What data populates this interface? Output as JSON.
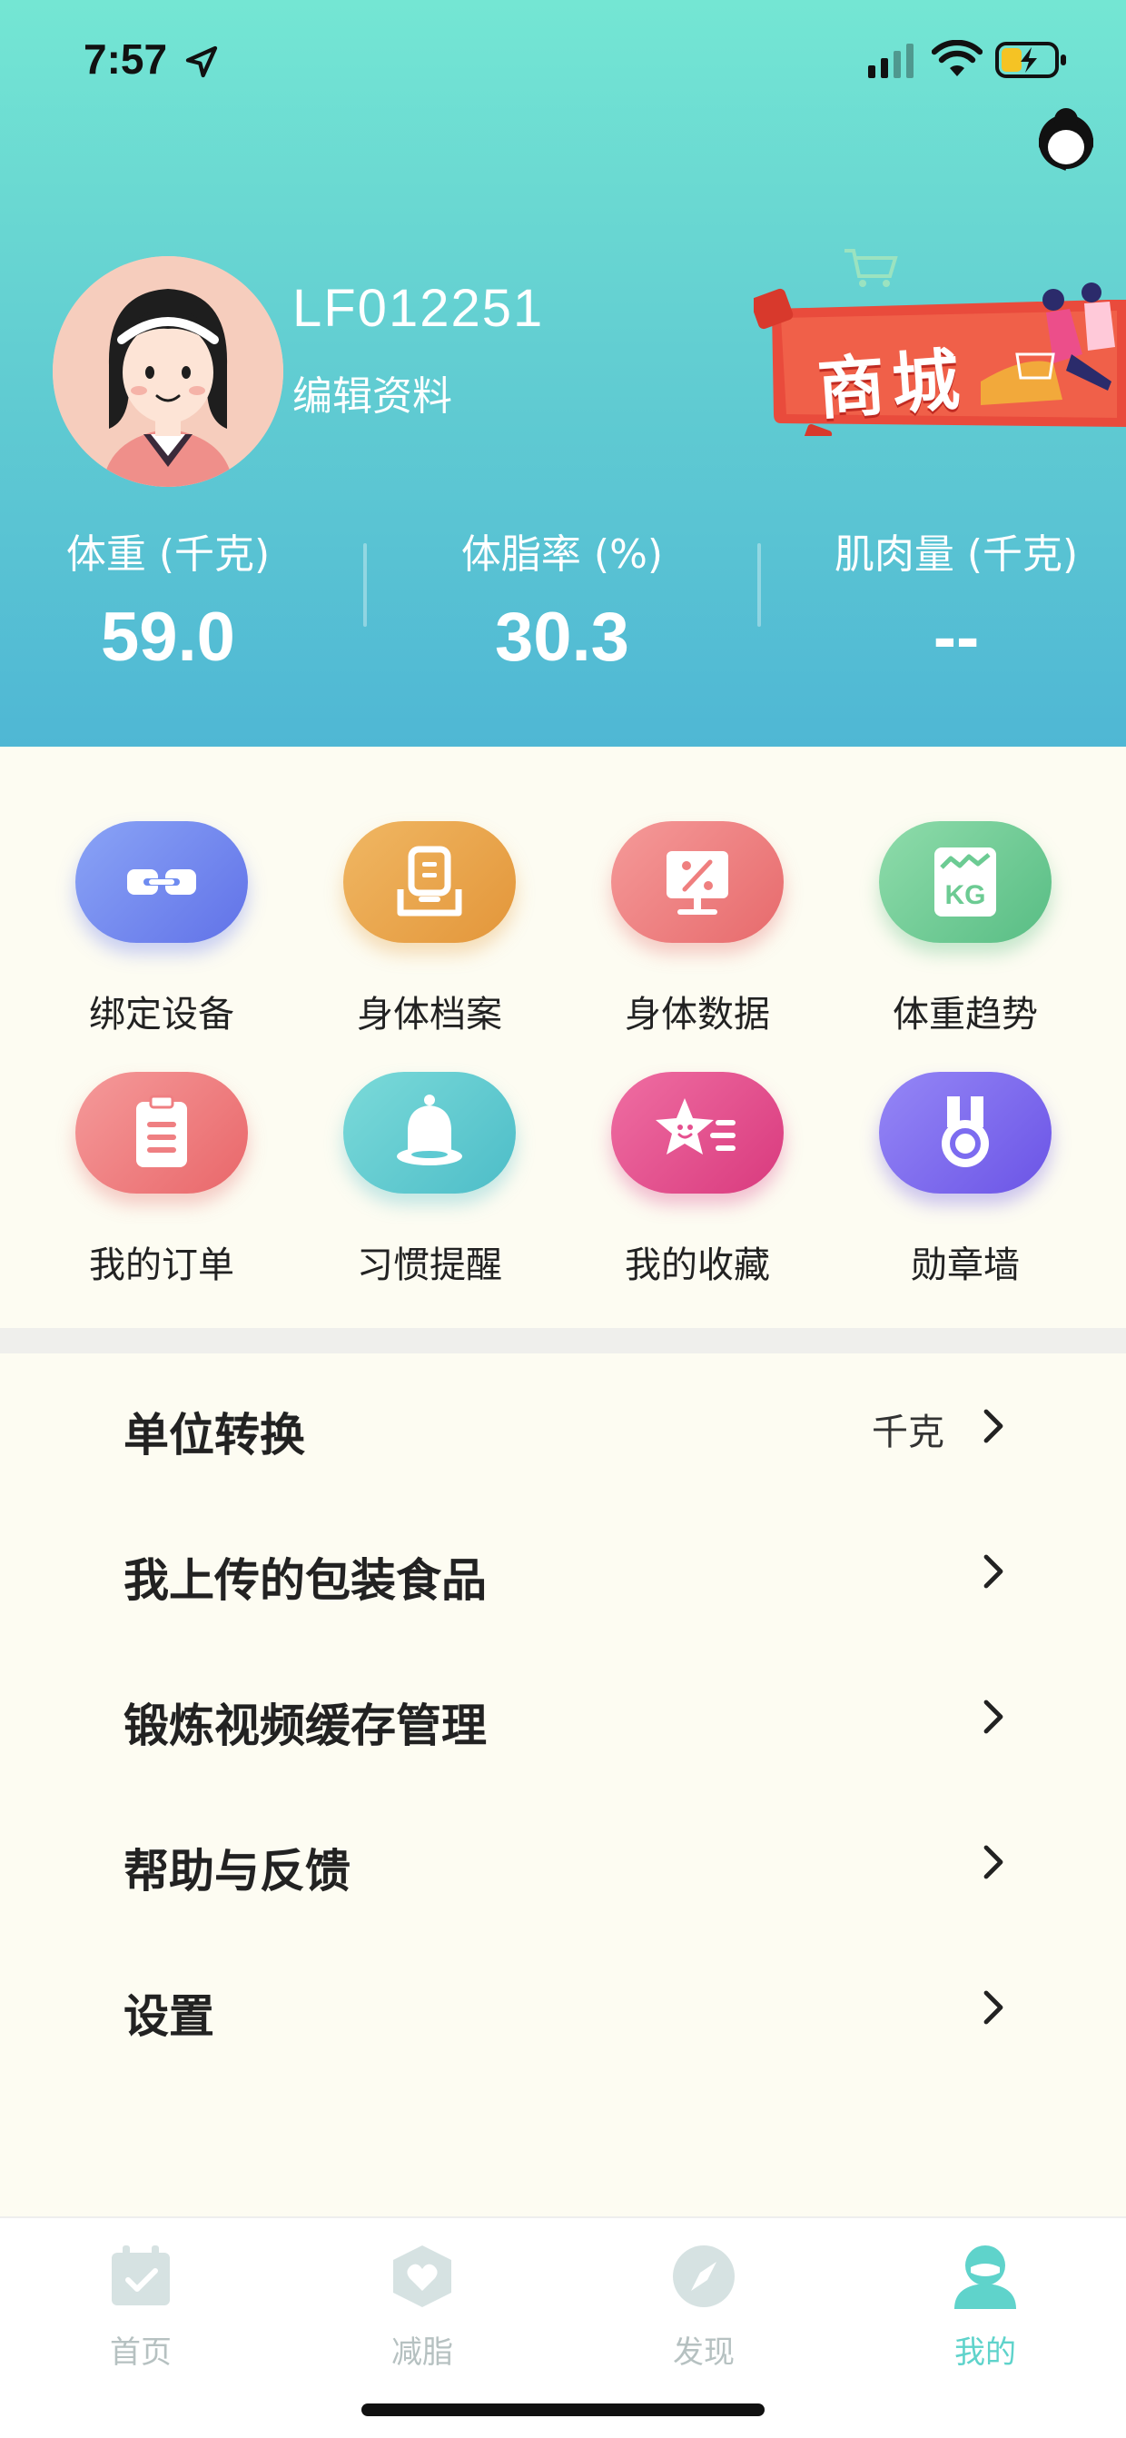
{
  "status_bar": {
    "time": "7:57",
    "battery_state": "charging",
    "wifi": "wifi-icon",
    "signal": "cellular-signal-icon"
  },
  "header": {
    "service_icon": "customer-service-icon",
    "username": "LF012251",
    "edit_profile": "编辑资料",
    "mall_label": "商城",
    "stats": [
      {
        "label": "体重 (千克)",
        "value": "59.0"
      },
      {
        "label": "体脂率 (%)",
        "value": "30.3"
      },
      {
        "label": "肌肉量 (千克)",
        "value": "--"
      }
    ]
  },
  "grid": [
    {
      "label": "绑定设备",
      "icon": "link-icon",
      "color": "#6f8cf0"
    },
    {
      "label": "身体档案",
      "icon": "profile-file-icon",
      "color": "#e9a74e"
    },
    {
      "label": "身体数据",
      "icon": "percent-monitor-icon",
      "color": "#ef7f7f"
    },
    {
      "label": "体重趋势",
      "icon": "kg-trend-icon",
      "color": "#6ccb93"
    },
    {
      "label": "我的订单",
      "icon": "clipboard-icon",
      "color": "#ef7f82"
    },
    {
      "label": "习惯提醒",
      "icon": "bell-icon",
      "color": "#5dcad2"
    },
    {
      "label": "我的收藏",
      "icon": "star-icon",
      "color": "#e5508f"
    },
    {
      "label": "勋章墙",
      "icon": "medal-icon",
      "color": "#7c6cf0"
    }
  ],
  "settings": [
    {
      "label": "单位转换",
      "value": "千克"
    },
    {
      "label": "我上传的包装食品",
      "value": ""
    },
    {
      "label": "锻炼视频缓存管理",
      "value": ""
    },
    {
      "label": "帮助与反馈",
      "value": ""
    },
    {
      "label": "设置",
      "value": ""
    }
  ],
  "tabbar": [
    {
      "label": "首页",
      "icon": "calendar-check-icon",
      "active": false
    },
    {
      "label": "减脂",
      "icon": "heart-hexagon-icon",
      "active": false
    },
    {
      "label": "发现",
      "icon": "compass-icon",
      "active": false
    },
    {
      "label": "我的",
      "icon": "profile-person-icon",
      "active": true
    }
  ],
  "colors": {
    "accent": "#5fd3cb",
    "header_top": "#74e6d3",
    "header_bottom": "#4fb7d4",
    "background": "#fdfcf2"
  }
}
